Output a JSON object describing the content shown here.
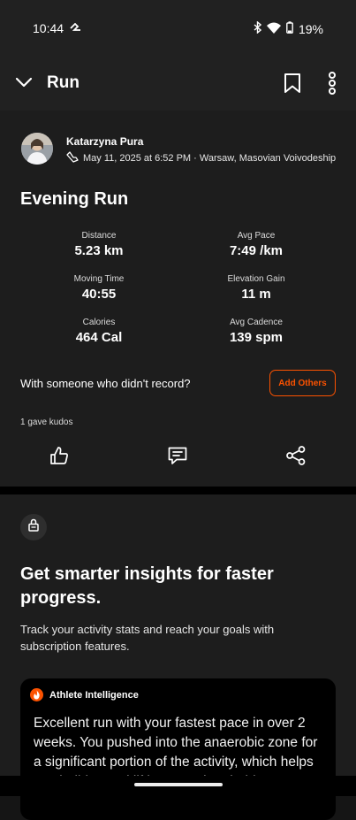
{
  "status": {
    "time": "10:44",
    "battery": "19%"
  },
  "header": {
    "title": "Run"
  },
  "activity": {
    "athlete": "Katarzyna Pura",
    "meta": "May 11, 2025 at 6:52 PM · Warsaw, Masovian Voivodeship",
    "title": "Evening Run",
    "stats": [
      {
        "label": "Distance",
        "value": "5.23 km"
      },
      {
        "label": "Avg Pace",
        "value": "7:49 /km"
      },
      {
        "label": "Moving Time",
        "value": "40:55"
      },
      {
        "label": "Elevation Gain",
        "value": "11 m"
      },
      {
        "label": "Calories",
        "value": "464 Cal"
      },
      {
        "label": "Avg Cadence",
        "value": "139 spm"
      }
    ],
    "with_prompt": "With someone who didn't record?",
    "add_others": "Add Others",
    "kudos": "1 gave kudos"
  },
  "promo": {
    "heading": "Get smarter insights for faster progress.",
    "subtitle": "Track your activity stats and reach your goals with subscription features.",
    "ai": {
      "label": "Athlete Intelligence",
      "text": "Excellent run with your fastest pace in over 2 weeks. You pushed into the anaerobic zone for a significant portion of the activity, which helps you build speed lifting your threshold."
    }
  },
  "colors": {
    "accent": "#fc5200",
    "background": "#151515",
    "card": "#1d1d1d"
  },
  "icons": [
    "chevron-down-icon",
    "bookmark-icon",
    "more-vertical-icon",
    "shoe-icon",
    "thumbs-up-icon",
    "comment-icon",
    "share-icon",
    "lock-icon",
    "flame-icon"
  ]
}
